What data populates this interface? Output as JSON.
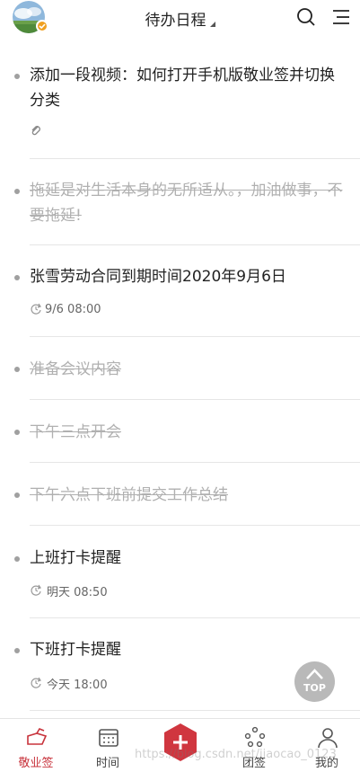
{
  "header": {
    "title": "待办日程",
    "icons": {
      "avatar": "avatar",
      "badge": "verified-badge",
      "search": "search-icon",
      "menu": "menu-icon"
    }
  },
  "colors": {
    "accent": "#c8333c",
    "done_text": "#b0b0b0",
    "divider": "#e6e6e6"
  },
  "items": [
    {
      "title": "添加一段视频：如何打开手机版敬业签并切换分类",
      "done": false,
      "meta_icon": "paperclip-icon",
      "meta": ""
    },
    {
      "title": "拖延是对生活本身的无所适从。，加油做事，不要拖延!",
      "done": true,
      "meta_icon": "",
      "meta": ""
    },
    {
      "title": "张雪劳动合同到期时间2020年9月6日",
      "done": false,
      "meta_icon": "reminder-icon",
      "meta": "9/6 08:00"
    },
    {
      "title": "准备会议内容",
      "done": true,
      "meta_icon": "",
      "meta": ""
    },
    {
      "title": "下午三点开会",
      "done": true,
      "meta_icon": "",
      "meta": ""
    },
    {
      "title": "下午六点下班前提交工作总结",
      "done": true,
      "meta_icon": "",
      "meta": ""
    },
    {
      "title": "上班打卡提醒",
      "done": false,
      "meta_icon": "repeat-reminder-icon",
      "meta": "明天 08:50"
    },
    {
      "title": "下班打卡提醒",
      "done": false,
      "meta_icon": "repeat-reminder-icon",
      "meta": "今天 18:00"
    }
  ],
  "top_button": {
    "label": "TOP"
  },
  "bottom_nav": [
    {
      "label": "敬业签",
      "icon": "notes-icon",
      "active": true
    },
    {
      "label": "时间",
      "icon": "calendar-icon",
      "active": false
    },
    {
      "label": "",
      "icon": "add-icon",
      "active": false
    },
    {
      "label": "团签",
      "icon": "team-icon",
      "active": false
    },
    {
      "label": "我的",
      "icon": "profile-icon",
      "active": false
    }
  ],
  "watermark": "https://blog.csdn.net/jiaocao_0123"
}
